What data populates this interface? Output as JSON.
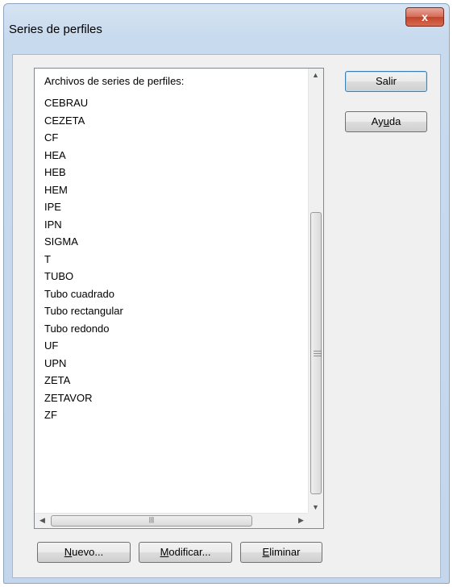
{
  "window": {
    "title": "Series de perfiles",
    "close_glyph": "x"
  },
  "list": {
    "header": "Archivos de series de perfiles:",
    "items": [
      "CEBRAU",
      "CEZETA",
      "CF",
      "HEA",
      "HEB",
      "HEM",
      "IPE",
      "IPN",
      "SIGMA",
      "T",
      "TUBO",
      "Tubo cuadrado",
      "Tubo rectangular",
      "Tubo redondo",
      "UF",
      "UPN",
      "ZETA",
      "ZETAVOR",
      "ZF"
    ]
  },
  "buttons": {
    "salir": "Salir",
    "ayuda": {
      "pre": "Ay",
      "accel": "u",
      "post": "da"
    },
    "nuevo": {
      "pre": "",
      "accel": "N",
      "post": "uevo..."
    },
    "modificar": {
      "pre": "",
      "accel": "M",
      "post": "odificar..."
    },
    "eliminar": {
      "pre": "",
      "accel": "E",
      "post": "liminar"
    }
  },
  "icons": {
    "close": "close-icon",
    "scroll_up": "scroll-up-arrow-icon",
    "scroll_down": "scroll-down-arrow-icon",
    "scroll_left": "scroll-left-arrow-icon",
    "scroll_right": "scroll-right-arrow-icon"
  }
}
